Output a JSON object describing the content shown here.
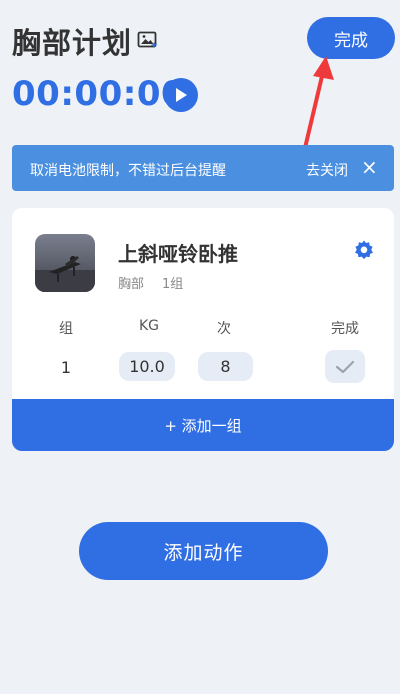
{
  "header": {
    "title": "胸部计划",
    "done_label": "完成"
  },
  "timer": {
    "value": "00:00:00"
  },
  "banner": {
    "text": "取消电池限制，不错过后台提醒",
    "link": "去关闭",
    "close": "×"
  },
  "exercise": {
    "name": "上斜哑铃卧推",
    "body_part": "胸部",
    "sets_count": "1组",
    "columns": {
      "set": "组",
      "kg": "KG",
      "reps": "次",
      "done": "完成"
    },
    "rows": [
      {
        "set": "1",
        "kg": "10.0",
        "reps": "8"
      }
    ],
    "add_set_label": "+ 添加一组"
  },
  "footer": {
    "add_action_label": "添加动作"
  },
  "colors": {
    "primary": "#2f6ee3",
    "banner": "#4a8fe0",
    "arrow": "#ee3a3a",
    "background": "#eef2f6"
  },
  "icons": [
    "image-edit-icon",
    "play-icon",
    "close-icon",
    "gear-icon",
    "check-icon"
  ]
}
